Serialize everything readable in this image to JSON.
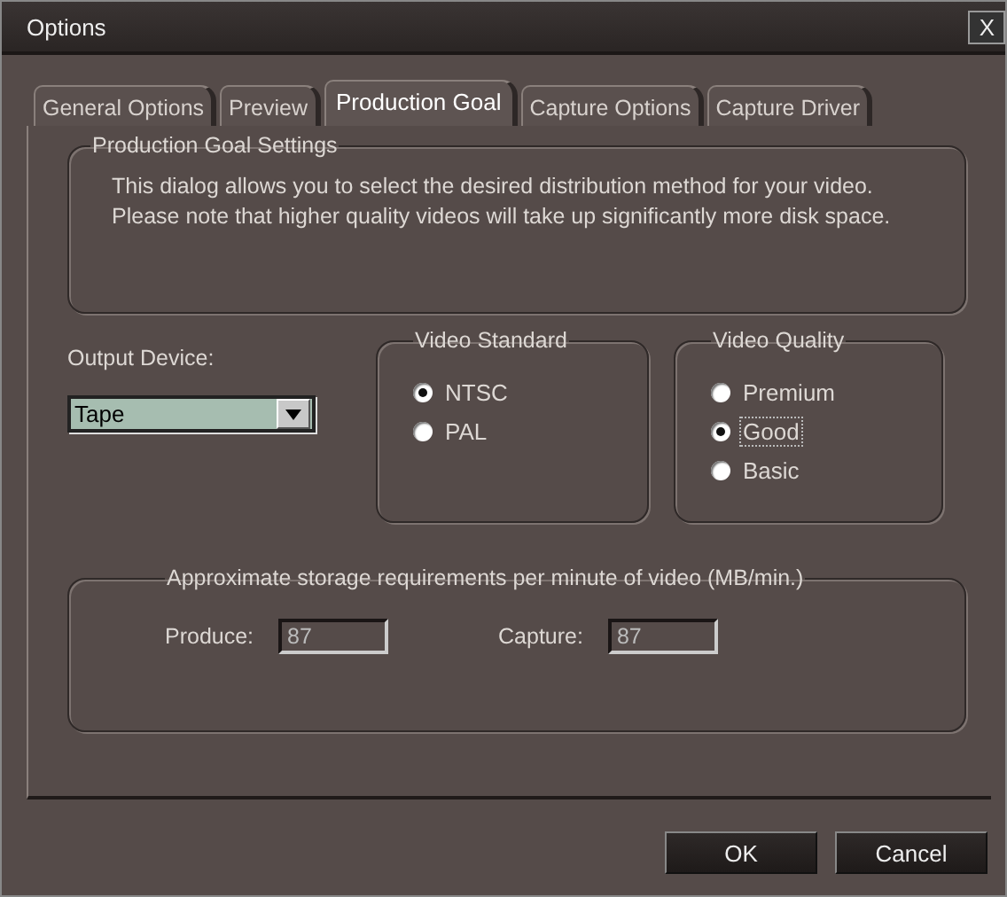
{
  "window": {
    "title": "Options",
    "close": "X"
  },
  "tabs": [
    {
      "label": "General Options",
      "selected": false
    },
    {
      "label": "Preview",
      "selected": false
    },
    {
      "label": "Production Goal",
      "selected": true
    },
    {
      "label": "Capture Options",
      "selected": false
    },
    {
      "label": "Capture Driver",
      "selected": false
    }
  ],
  "settings": {
    "title": "Production Goal Settings",
    "text": "This dialog allows you to select the desired distribution method for your video. Please note that higher quality videos will take up significantly more disk space."
  },
  "output_device": {
    "label": "Output Device:",
    "value": "Tape"
  },
  "video_standard": {
    "title": "Video Standard",
    "options": [
      {
        "label": "NTSC",
        "selected": true
      },
      {
        "label": "PAL",
        "selected": false
      }
    ]
  },
  "video_quality": {
    "title": "Video Quality",
    "options": [
      {
        "label": "Premium",
        "selected": false
      },
      {
        "label": "Good",
        "selected": true
      },
      {
        "label": "Basic",
        "selected": false
      }
    ]
  },
  "storage": {
    "title": "Approximate storage requirements per minute of video (MB/min.)",
    "produce_label": "Produce:",
    "produce": "87",
    "capture_label": "Capture:",
    "capture": "87"
  },
  "buttons": [
    "OK",
    "Cancel"
  ]
}
